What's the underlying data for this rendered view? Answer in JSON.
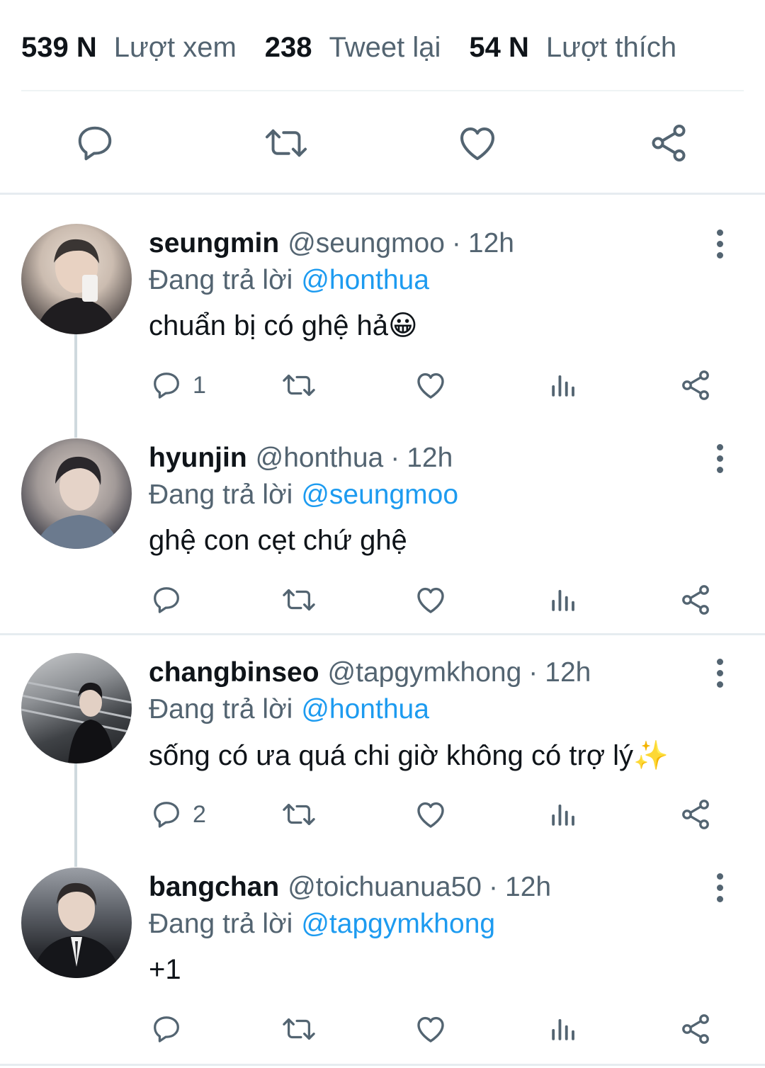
{
  "stats": [
    {
      "value": "539 N",
      "label": "Lượt xem"
    },
    {
      "value": "238",
      "label": "Tweet lại"
    },
    {
      "value": "54 N",
      "label": "Lượt thích"
    }
  ],
  "replying_prefix": "Đang trả lời",
  "tweets": [
    {
      "name": "seungmin",
      "handle": "@seungmoo",
      "dot": "·",
      "time": "12h",
      "replying_to": "@honthua",
      "text": "chuẩn bị có ghệ hả😀",
      "reply_count": "1"
    },
    {
      "name": "hyunjin",
      "handle": "@honthua",
      "dot": "·",
      "time": "12h",
      "replying_to": "@seungmoo",
      "text": "ghệ con cẹt chứ ghệ",
      "reply_count": ""
    },
    {
      "name": "changbinseo",
      "handle": "@tapgymkhong",
      "dot": "·",
      "time": "12h",
      "replying_to": "@honthua",
      "text": "sống có ưa quá chi giờ không có trợ lý✨",
      "reply_count": "2"
    },
    {
      "name": "bangchan",
      "handle": "@toichuanua50",
      "dot": "·",
      "time": "12h",
      "replying_to": "@tapgymkhong",
      "text": "+1",
      "reply_count": ""
    }
  ],
  "icons": [
    "reply-icon",
    "retweet-icon",
    "like-icon",
    "views-icon",
    "share-icon",
    "more-icon"
  ],
  "colors": {
    "text": "#0f1419",
    "secondary": "#536471",
    "accent": "#1d9bf0",
    "divider": "#eff3f4"
  }
}
